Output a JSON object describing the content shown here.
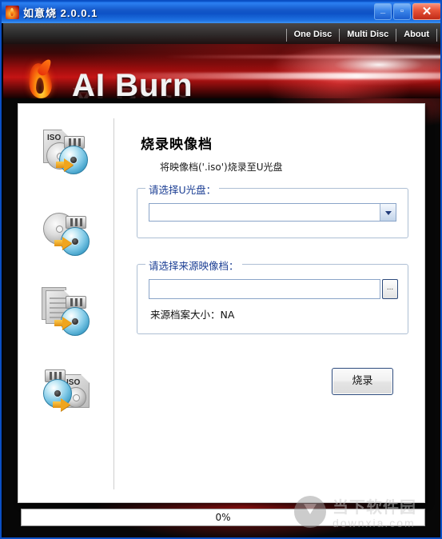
{
  "window": {
    "title": "如意烧 2.0.0.1",
    "app_icon": "flame-icon",
    "minimize_label": "_",
    "maximize_label": "▫",
    "close_label": "✕"
  },
  "banner": {
    "logo_text": "AI Burn",
    "logo_icon": "flame-logo-icon",
    "nav": [
      {
        "label": "One Disc",
        "name": "nav-one-disc"
      },
      {
        "label": "Multi Disc",
        "name": "nav-multi-disc"
      },
      {
        "label": "About",
        "name": "nav-about"
      }
    ]
  },
  "sidebar": {
    "items": [
      {
        "icon": "iso-to-usb-disc-icon",
        "name": "sidebar-icon-iso-to-disc"
      },
      {
        "icon": "disc-to-usb-disc-icon",
        "name": "sidebar-icon-disc-copy"
      },
      {
        "icon": "files-to-usb-disc-icon",
        "name": "sidebar-icon-files-to-disc"
      },
      {
        "icon": "disc-to-iso-icon",
        "name": "sidebar-icon-disc-to-iso"
      }
    ]
  },
  "content": {
    "title": "烧录映像档",
    "subtitle": "将映像档('.iso')烧录至U光盘",
    "usb_group": {
      "label": "请选择U光盘：",
      "combo_value": "",
      "combo_placeholder": ""
    },
    "iso_group": {
      "label": "请选择来源映像档：",
      "path_value": "",
      "path_placeholder": "",
      "browse_label": "...",
      "size_label": "来源档案大小：NA"
    },
    "burn_button": "烧录"
  },
  "status": {
    "progress_text": "0%",
    "progress_percent": 0
  },
  "watermark": {
    "cn": "当下软件园",
    "en": "downxia.com",
    "icon": "download-arrow-icon"
  },
  "colors": {
    "title_bar": "#1457c8",
    "banner_red": "#c41414",
    "group_label_blue": "#1c3f94",
    "panel_bg": "#ffffff"
  }
}
